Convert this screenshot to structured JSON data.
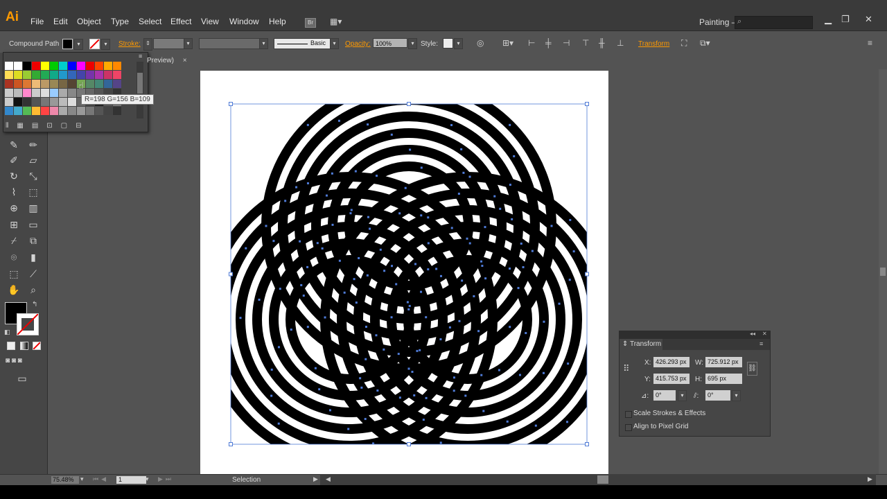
{
  "app": {
    "logo": "Ai",
    "workspace": "Painting –"
  },
  "menu": [
    "File",
    "Edit",
    "Object",
    "Type",
    "Select",
    "Effect",
    "View",
    "Window",
    "Help"
  ],
  "menu_badge": "Br",
  "control": {
    "object_type": "Compound Path",
    "stroke_label": "Stroke:",
    "brush_label": "Basic",
    "opacity_label": "Opacity:",
    "opacity_value": "100%",
    "style_label": "Style:",
    "transform_link": "Transform"
  },
  "doc_tab": "Preview)",
  "doc_close": "×",
  "swatch_tooltip": "R=198 G=156 B=109",
  "transform_panel": {
    "title": "Transform",
    "x_label": "X:",
    "x_value": "426.293 px",
    "y_label": "Y:",
    "y_value": "415.753 px",
    "w_label": "W:",
    "w_value": "725.912 px",
    "h_label": "H:",
    "h_value": "695 px",
    "rotate_value": "0°",
    "shear_value": "0°",
    "scale_strokes": "Scale Strokes & Effects",
    "align_pixel": "Align to Pixel Grid"
  },
  "status": {
    "zoom": "75.48%",
    "page": "1",
    "tool": "Selection"
  },
  "colors": {
    "accent": "#ff9a00",
    "selection": "#4f7bd6",
    "fill": "#000000"
  },
  "icons": [
    "search-icon",
    "minimize-icon",
    "restore-icon",
    "close-icon",
    "pen-icon",
    "brush-icon",
    "pencil-icon",
    "eraser-icon",
    "rotate-icon",
    "scale-icon",
    "warp-icon",
    "graph-icon",
    "mesh-icon",
    "gradient-icon",
    "eyedropper-icon",
    "blend-icon",
    "symbol-sprayer-icon",
    "column-graph-icon",
    "artboard-icon",
    "slice-icon",
    "hand-icon",
    "zoom-icon",
    "link-icon",
    "reference-point-icon"
  ]
}
